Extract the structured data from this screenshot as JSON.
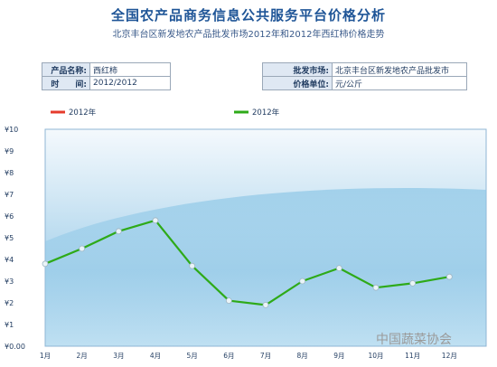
{
  "header": {
    "title": "全国农产品商务信息公共服务平台价格分析",
    "subtitle": "北京丰台区新发地农产品批发市场2012年和2012年西红柿价格走势"
  },
  "info_left": {
    "product_label": "产品名称:",
    "product_value": "西红柿",
    "time_label": "时　　间:",
    "time_value": "2012/2012"
  },
  "info_right": {
    "market_label": "批发市场:",
    "market_value": "北京丰台区新发地农产品批发市",
    "unit_label": "价格单位:",
    "unit_value": "元/公斤"
  },
  "watermark": "中国蔬菜协会",
  "colors": {
    "accent_line": "#2eaa18",
    "legend_red": "#e53b2c",
    "title_blue": "#1f5597"
  },
  "chart_data": {
    "type": "line",
    "categories": [
      "1月",
      "2月",
      "3月",
      "4月",
      "5月",
      "6月",
      "7月",
      "8月",
      "9月",
      "10月",
      "11月",
      "12月"
    ],
    "series": [
      {
        "name": "2012年",
        "color": "#e53b2c",
        "values": []
      },
      {
        "name": "2012年",
        "color": "#2eaa18",
        "values": [
          3.8,
          4.5,
          5.3,
          5.8,
          3.7,
          2.1,
          1.9,
          3.0,
          3.6,
          2.7,
          2.9,
          3.2
        ]
      }
    ],
    "ylim": [
      0,
      10
    ],
    "yticks": [
      "¥0.00",
      "¥1",
      "¥2",
      "¥3",
      "¥4",
      "¥5",
      "¥6",
      "¥7",
      "¥8",
      "¥9",
      "¥10"
    ],
    "legend": "top-left",
    "grid": false
  }
}
